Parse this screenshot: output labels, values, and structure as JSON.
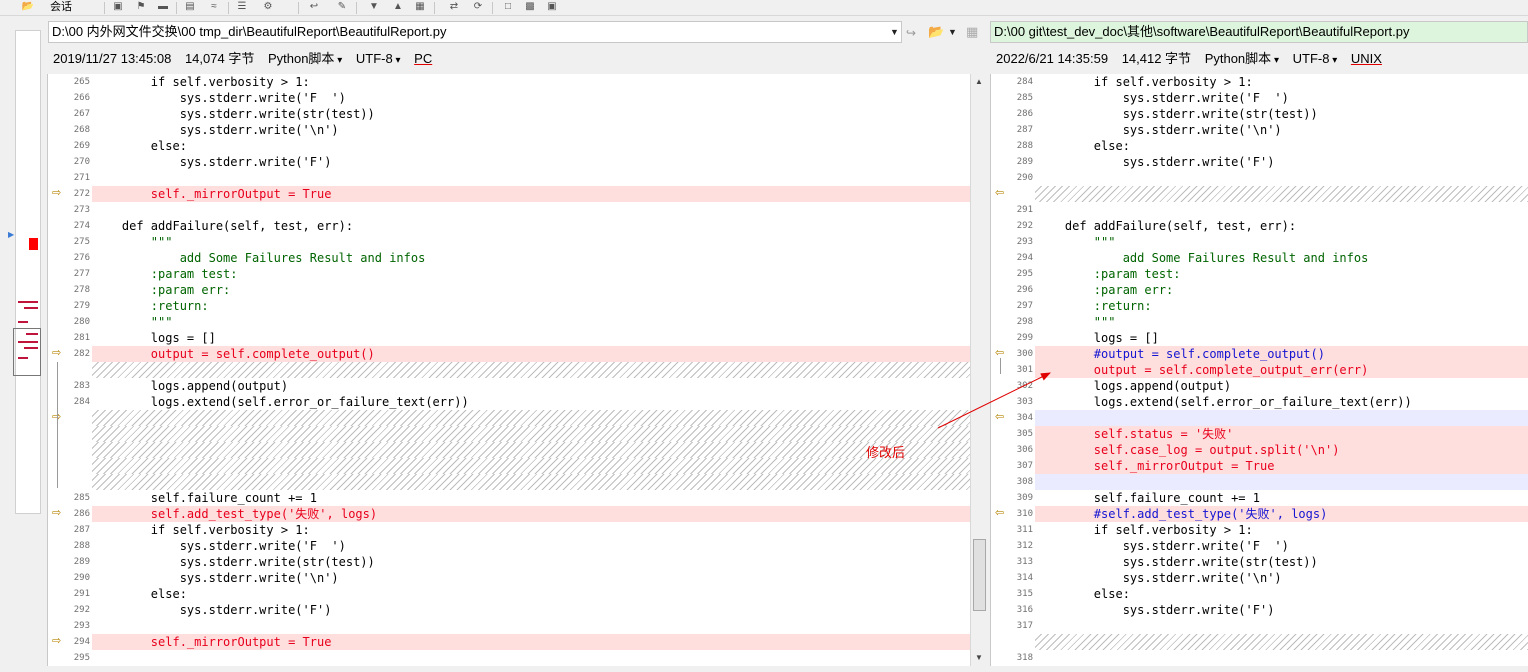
{
  "toolbar": {
    "menu_label": "会话"
  },
  "left": {
    "path": "D:\\00 内外网文件交换\\00 tmp_dir\\BeautifulReport\\BeautifulReport.py",
    "datetime": "2019/11/27 13:45:08",
    "size": "14,074 字节",
    "format": "Python脚本",
    "encoding": "UTF-8",
    "eol": "PC"
  },
  "right": {
    "path": "D:\\00 git\\test_dev_doc\\其他\\software\\BeautifulReport\\BeautifulReport.py",
    "datetime": "2022/6/21 14:35:59",
    "size": "14,412 字节",
    "format": "Python脚本",
    "encoding": "UTF-8",
    "eol": "UNIX"
  },
  "annotation": {
    "text": "修改后"
  },
  "left_lines": [
    {
      "n": "265",
      "t": "        if self.verbosity > 1:",
      "k": ""
    },
    {
      "n": "266",
      "t": "            sys.stderr.write('F  ')",
      "k": ""
    },
    {
      "n": "267",
      "t": "            sys.stderr.write(str(test))",
      "k": ""
    },
    {
      "n": "268",
      "t": "            sys.stderr.write('\\n')",
      "k": ""
    },
    {
      "n": "269",
      "t": "        else:",
      "k": ""
    },
    {
      "n": "270",
      "t": "            sys.stderr.write('F')",
      "k": ""
    },
    {
      "n": "271",
      "t": "",
      "k": ""
    },
    {
      "n": "272",
      "t": "        self._mirrorOutput = True",
      "k": "chg-red",
      "m": "arrow"
    },
    {
      "n": "273",
      "t": "",
      "k": ""
    },
    {
      "n": "274",
      "t": "    def addFailure(self, test, err):",
      "k": ""
    },
    {
      "n": "275",
      "t": "        \"\"\"",
      "k": "green"
    },
    {
      "n": "276",
      "t": "            add Some Failures Result and infos",
      "k": "green"
    },
    {
      "n": "277",
      "t": "        :param test:",
      "k": "green"
    },
    {
      "n": "278",
      "t": "        :param err:",
      "k": "green"
    },
    {
      "n": "279",
      "t": "        :return:",
      "k": "green"
    },
    {
      "n": "280",
      "t": "        \"\"\"",
      "k": "green"
    },
    {
      "n": "281",
      "t": "        logs = []",
      "k": ""
    },
    {
      "n": "282",
      "t": "        output = self.complete_output()",
      "k": "chg-red",
      "m": "arrow"
    },
    {
      "n": "",
      "t": "",
      "k": "hatch"
    },
    {
      "n": "283",
      "t": "        logs.append(output)",
      "k": ""
    },
    {
      "n": "284",
      "t": "        logs.extend(self.error_or_failure_text(err))",
      "k": ""
    },
    {
      "n": "",
      "t": "",
      "k": "hatch",
      "m": "arrow"
    },
    {
      "n": "",
      "t": "",
      "k": "hatch"
    },
    {
      "n": "",
      "t": "",
      "k": "hatch"
    },
    {
      "n": "",
      "t": "",
      "k": "hatch"
    },
    {
      "n": "",
      "t": "",
      "k": "hatch"
    },
    {
      "n": "285",
      "t": "        self.failure_count += 1",
      "k": ""
    },
    {
      "n": "286",
      "t": "        self.add_test_type('失败', logs)",
      "k": "chg-red",
      "m": "arrow"
    },
    {
      "n": "287",
      "t": "        if self.verbosity > 1:",
      "k": ""
    },
    {
      "n": "288",
      "t": "            sys.stderr.write('F  ')",
      "k": ""
    },
    {
      "n": "289",
      "t": "            sys.stderr.write(str(test))",
      "k": ""
    },
    {
      "n": "290",
      "t": "            sys.stderr.write('\\n')",
      "k": ""
    },
    {
      "n": "291",
      "t": "        else:",
      "k": ""
    },
    {
      "n": "292",
      "t": "            sys.stderr.write('F')",
      "k": ""
    },
    {
      "n": "293",
      "t": "",
      "k": ""
    },
    {
      "n": "294",
      "t": "        self._mirrorOutput = True",
      "k": "chg-red",
      "m": "arrow"
    },
    {
      "n": "295",
      "t": "",
      "k": ""
    }
  ],
  "right_lines": [
    {
      "n": "284",
      "t": "        if self.verbosity > 1:",
      "k": ""
    },
    {
      "n": "285",
      "t": "            sys.stderr.write('F  ')",
      "k": ""
    },
    {
      "n": "286",
      "t": "            sys.stderr.write(str(test))",
      "k": ""
    },
    {
      "n": "287",
      "t": "            sys.stderr.write('\\n')",
      "k": ""
    },
    {
      "n": "288",
      "t": "        else:",
      "k": ""
    },
    {
      "n": "289",
      "t": "            sys.stderr.write('F')",
      "k": ""
    },
    {
      "n": "290",
      "t": "",
      "k": ""
    },
    {
      "n": "",
      "t": "",
      "k": "hatch",
      "m": "larrow"
    },
    {
      "n": "291",
      "t": "",
      "k": ""
    },
    {
      "n": "292",
      "t": "    def addFailure(self, test, err):",
      "k": ""
    },
    {
      "n": "293",
      "t": "        \"\"\"",
      "k": "green"
    },
    {
      "n": "294",
      "t": "            add Some Failures Result and infos",
      "k": "green"
    },
    {
      "n": "295",
      "t": "        :param test:",
      "k": "green"
    },
    {
      "n": "296",
      "t": "        :param err:",
      "k": "green"
    },
    {
      "n": "297",
      "t": "        :return:",
      "k": "green"
    },
    {
      "n": "298",
      "t": "        \"\"\"",
      "k": "green"
    },
    {
      "n": "299",
      "t": "        logs = []",
      "k": ""
    },
    {
      "n": "300",
      "t": "        #output = self.complete_output()",
      "k": "chg-blue",
      "m": "larrow"
    },
    {
      "n": "301",
      "t": "        output = self.complete_output_err(err)",
      "k": "chg-red"
    },
    {
      "n": "302",
      "t": "        logs.append(output)",
      "k": ""
    },
    {
      "n": "303",
      "t": "        logs.extend(self.error_or_failure_text(err))",
      "k": ""
    },
    {
      "n": "304",
      "t": "",
      "k": "ins",
      "m": "larrow"
    },
    {
      "n": "305",
      "t": "        self.status = '失败'",
      "k": "chg-red"
    },
    {
      "n": "306",
      "t": "        self.case_log = output.split('\\n')",
      "k": "chg-red"
    },
    {
      "n": "307",
      "t": "        self._mirrorOutput = True",
      "k": "chg-red"
    },
    {
      "n": "308",
      "t": "",
      "k": "ins"
    },
    {
      "n": "309",
      "t": "        self.failure_count += 1",
      "k": ""
    },
    {
      "n": "310",
      "t": "        #self.add_test_type('失败', logs)",
      "k": "chg-blue",
      "m": "larrow"
    },
    {
      "n": "311",
      "t": "        if self.verbosity > 1:",
      "k": ""
    },
    {
      "n": "312",
      "t": "            sys.stderr.write('F  ')",
      "k": ""
    },
    {
      "n": "313",
      "t": "            sys.stderr.write(str(test))",
      "k": ""
    },
    {
      "n": "314",
      "t": "            sys.stderr.write('\\n')",
      "k": ""
    },
    {
      "n": "315",
      "t": "        else:",
      "k": ""
    },
    {
      "n": "316",
      "t": "            sys.stderr.write('F')",
      "k": ""
    },
    {
      "n": "317",
      "t": "",
      "k": ""
    },
    {
      "n": "",
      "t": "",
      "k": "hatch"
    },
    {
      "n": "318",
      "t": "",
      "k": ""
    }
  ],
  "colors": {
    "changed_bg": "#ffdede",
    "changed_text": "#e8001c",
    "comment_text": "#1414d2",
    "docstring_text": "#006400",
    "inserted_bg": "#ebebff",
    "right_path_bg": "#dcf5dc",
    "annotation": "#e00000"
  }
}
